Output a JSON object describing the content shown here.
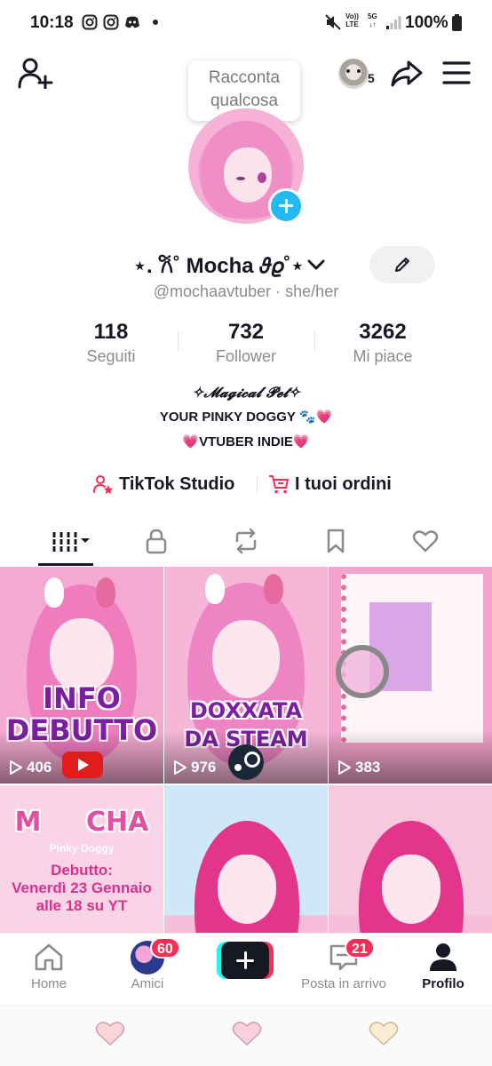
{
  "status_bar": {
    "time": "10:18",
    "net_vo": "Vo))",
    "net_lte": "LTE",
    "net_5g": "5G",
    "net_arrows": "↓↑",
    "battery": "100%",
    "icons": [
      "instagram-icon",
      "instagram-icon",
      "discord-icon",
      "mute-icon",
      "signal-icon",
      "battery-icon"
    ]
  },
  "header": {
    "story_prompt_line1": "Racconta",
    "story_prompt_line2": "qualcosa",
    "viewers_count": "5"
  },
  "profile": {
    "display_name": "⋆. 𐙚˚ Mocha 𝜗𝜚˚⋆",
    "handle": "@mochaavtuber",
    "separator": "·",
    "pronouns": "she/her"
  },
  "stats": [
    {
      "value": "118",
      "label": "Seguiti"
    },
    {
      "value": "732",
      "label": "Follower"
    },
    {
      "value": "3262",
      "label": "Mi piace"
    }
  ],
  "bio": {
    "line1": "✧𝓜𝓪𝓰𝓲𝓬𝓪𝓵 𝓟𝓮𝓽✧",
    "line2": "YOUR PINKY DOGGY 🐾💗",
    "line3": "💗VTUBER INDIE💗"
  },
  "links": {
    "studio": "TikTok Studio",
    "orders": "I tuoi ordini"
  },
  "videos": [
    {
      "views": "406",
      "caption": [
        "INFO",
        "DEBUTTO"
      ]
    },
    {
      "views": "976",
      "caption": [
        "DOXXATA",
        "DA STEAM"
      ]
    },
    {
      "views": "383",
      "caption": []
    },
    {
      "views": "",
      "caption": [
        "M",
        "CHA"
      ],
      "sub1": "Pinky Doggy",
      "sub2": "Debutto:",
      "sub3": "Venerdì 23 Gennaio",
      "sub4": "alle 18 su YT"
    },
    {
      "views": "",
      "caption": []
    },
    {
      "views": "",
      "caption": []
    }
  ],
  "bottom_nav": {
    "home": "Home",
    "friends": "Amici",
    "friends_badge": "60",
    "inbox": "Posta in arrivo",
    "inbox_badge": "21",
    "profile": "Profilo"
  },
  "colors": {
    "accent_pink": "#fe2c55",
    "accent_cyan": "#25f4ee",
    "plus_blue": "#23b9f2",
    "grid_pink": "#f4a7cf"
  }
}
